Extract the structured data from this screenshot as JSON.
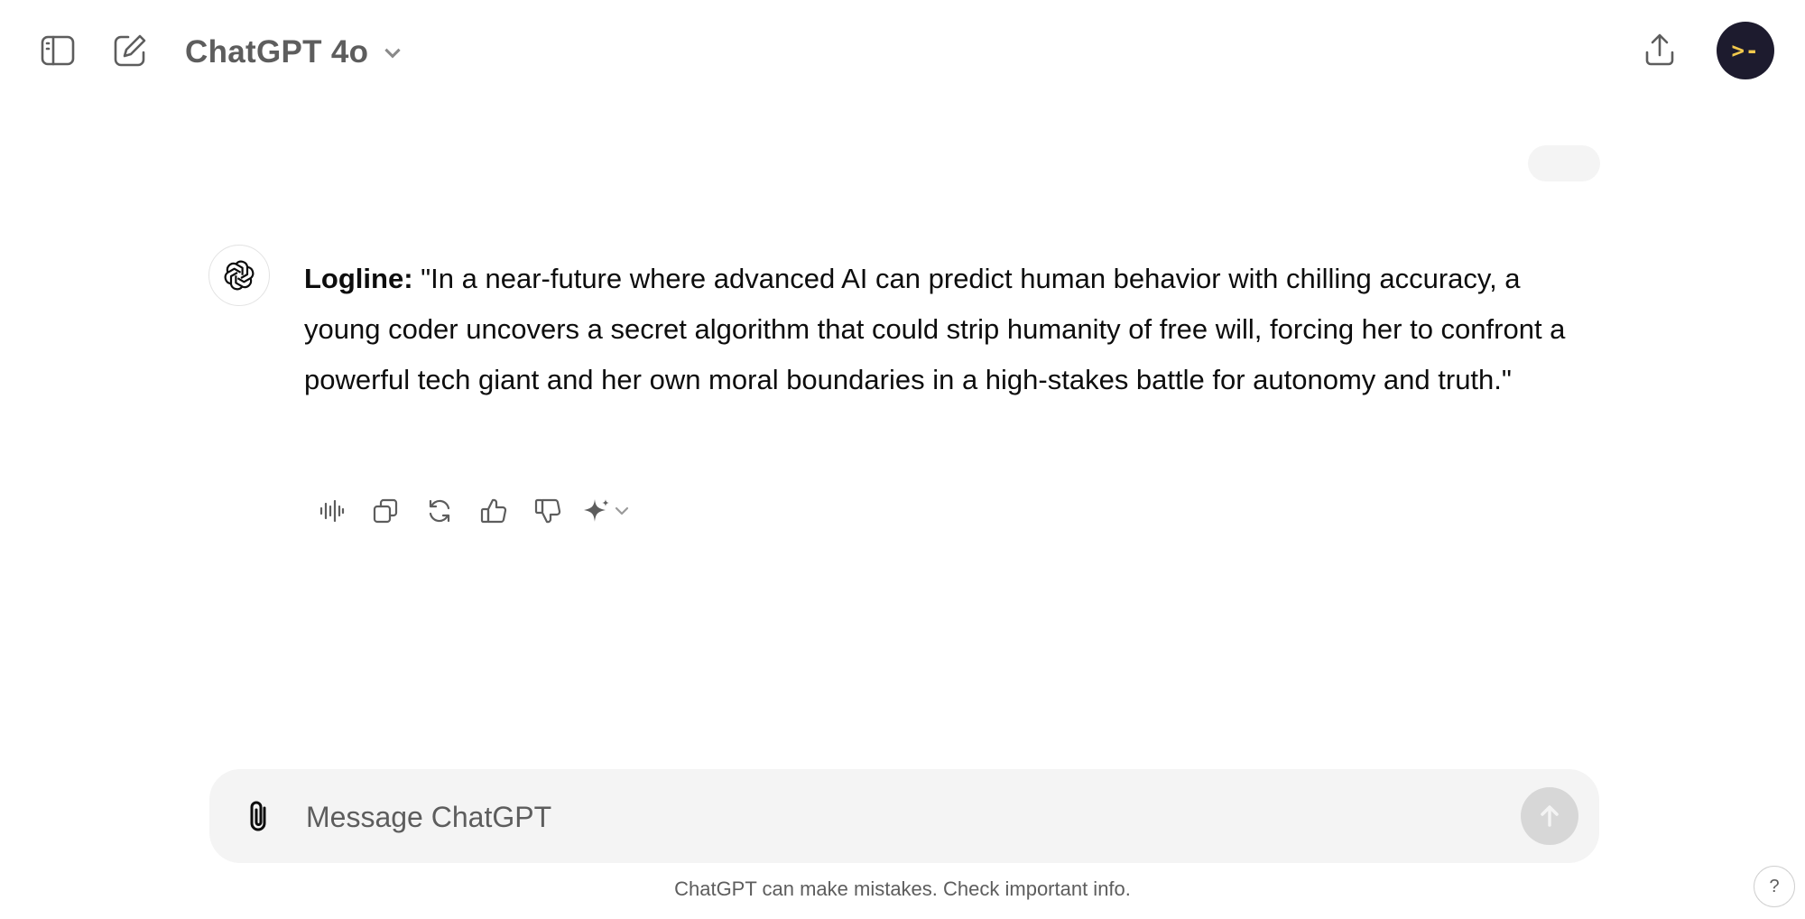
{
  "header": {
    "model_name": "ChatGPT 4o",
    "icons": {
      "sidebar": "sidebar-toggle-icon",
      "new_chat": "new-chat-icon",
      "model_dropdown": "chevron-down-icon",
      "share": "share-icon"
    },
    "avatar_glyph": ">-"
  },
  "message": {
    "label": "Logline:",
    "text": " \"In a near-future where advanced AI can predict human behavior with chilling accuracy, a young coder uncovers a secret algorithm that could strip humanity of free will, forcing her to confront a powerful tech giant and her own moral boundaries in a high-stakes battle for autonomy and truth.\""
  },
  "actions": [
    "read-aloud-icon",
    "copy-icon",
    "regenerate-icon",
    "thumbs-up-icon",
    "thumbs-down-icon",
    "sparkle-icon"
  ],
  "composer": {
    "placeholder": "Message ChatGPT"
  },
  "footer": {
    "disclaimer": "ChatGPT can make mistakes. Check important info.",
    "help": "?"
  },
  "colors": {
    "background": "#ffffff",
    "composer_bg": "#f4f4f4",
    "avatar_bg": "#1d1b2e",
    "avatar_glyph": "#f2c94c",
    "send_disabled": "#d7d7d7"
  }
}
